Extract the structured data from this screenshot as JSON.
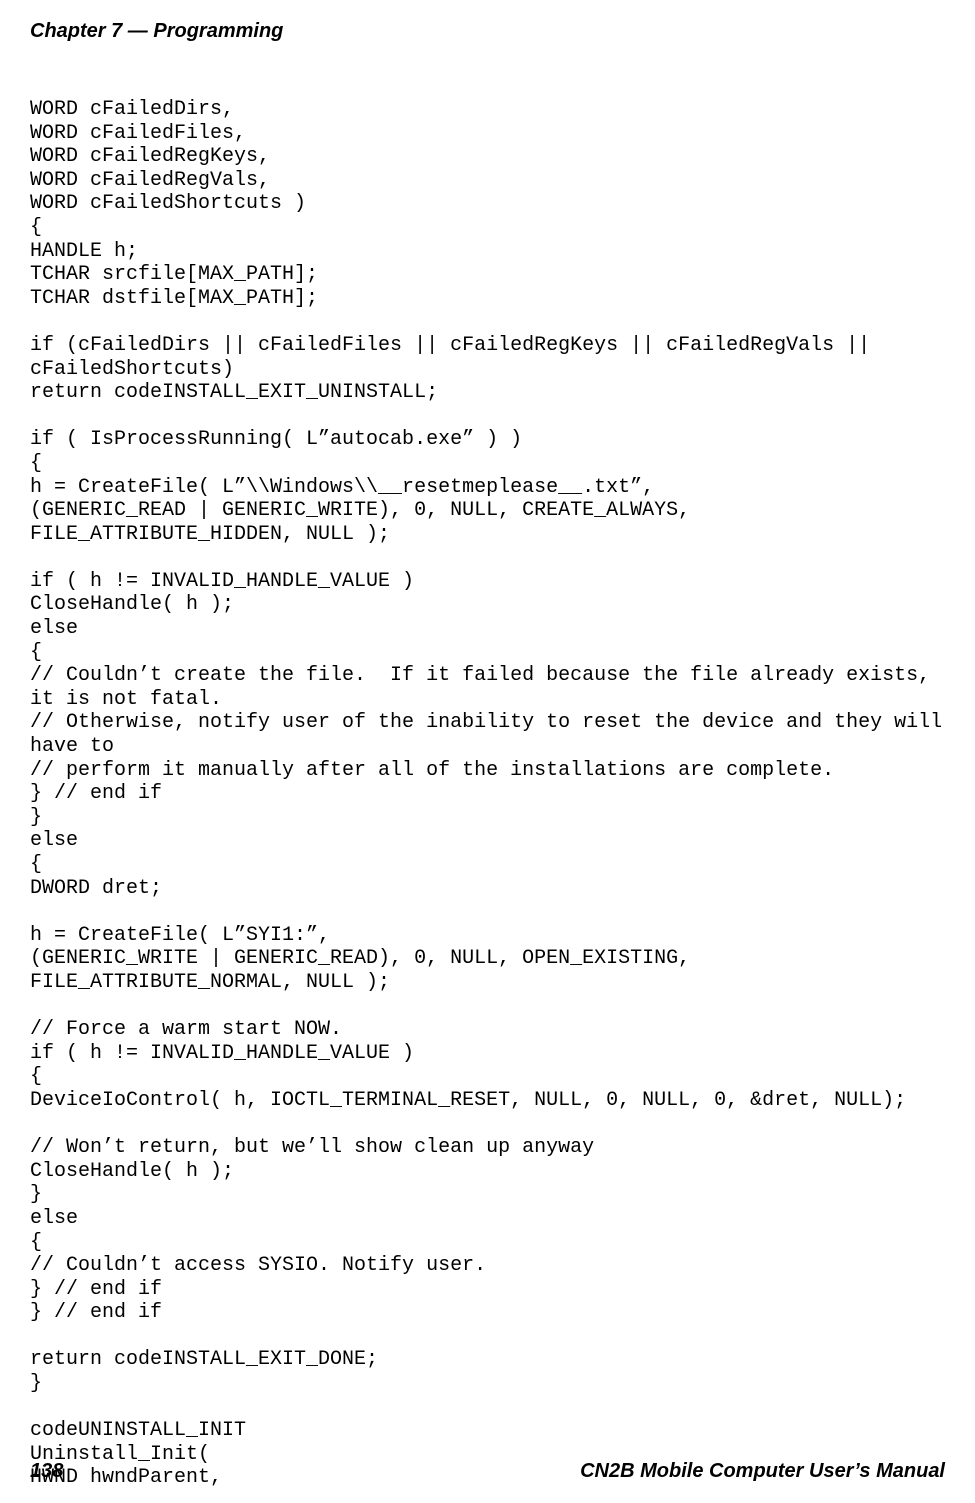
{
  "header": {
    "chapter": "Chapter 7 — Programming"
  },
  "code": {
    "l01": "WORD cFailedDirs,",
    "l02": "WORD cFailedFiles,",
    "l03": "WORD cFailedRegKeys,",
    "l04": "WORD cFailedRegVals,",
    "l05": "WORD cFailedShortcuts )",
    "l06": "{",
    "l07": "HANDLE h;",
    "l08": "TCHAR srcfile[MAX_PATH];",
    "l09": "TCHAR dstfile[MAX_PATH];",
    "l10": "",
    "l11": "if (cFailedDirs || cFailedFiles || cFailedRegKeys || cFailedRegVals || cFailedShortcuts)",
    "l12": "return codeINSTALL_EXIT_UNINSTALL;",
    "l13": "",
    "l14": "if ( IsProcessRunning( L”autocab.exe” ) )",
    "l15": "{",
    "l16": "h = CreateFile( L”\\\\Windows\\\\__resetmeplease__.txt”,",
    "l17": "(GENERIC_READ | GENERIC_WRITE), 0, NULL, CREATE_ALWAYS,",
    "l18": "FILE_ATTRIBUTE_HIDDEN, NULL );",
    "l19": "",
    "l20": "if ( h != INVALID_HANDLE_VALUE )",
    "l21": "CloseHandle( h );",
    "l22": "else",
    "l23": "{",
    "l24": "// Couldn’t create the file.  If it failed because the file already exists, it is not fatal.",
    "l25": "// Otherwise, notify user of the inability to reset the device and they will have to",
    "l26": "// perform it manually after all of the installations are complete.",
    "l27": "} // end if",
    "l28": "}",
    "l29": "else",
    "l30": "{",
    "l31": "DWORD dret;",
    "l32": "",
    "l33": "h = CreateFile( L”SYI1:”,",
    "l34": "(GENERIC_WRITE | GENERIC_READ), 0, NULL, OPEN_EXISTING,",
    "l35": "FILE_ATTRIBUTE_NORMAL, NULL );",
    "l36": "",
    "l37": "// Force a warm start NOW.",
    "l38": "if ( h != INVALID_HANDLE_VALUE )",
    "l39": "{",
    "l40": "DeviceIoControl( h, IOCTL_TERMINAL_RESET, NULL, 0, NULL, 0, &dret, NULL);",
    "l41": "",
    "l42": "// Won’t return, but we’ll show clean up anyway",
    "l43": "CloseHandle( h );",
    "l44": "}",
    "l45": "else",
    "l46": "{",
    "l47": "// Couldn’t access SYSIO. Notify user.",
    "l48": "} // end if",
    "l49": "} // end if",
    "l50": "",
    "l51": "return codeINSTALL_EXIT_DONE;",
    "l52": "}",
    "l53": "",
    "l54": "codeUNINSTALL_INIT",
    "l55": "Uninstall_Init(",
    "l56": "HWND hwndParent,"
  },
  "footer": {
    "page": "138",
    "title": "CN2B Mobile Computer User’s Manual"
  }
}
